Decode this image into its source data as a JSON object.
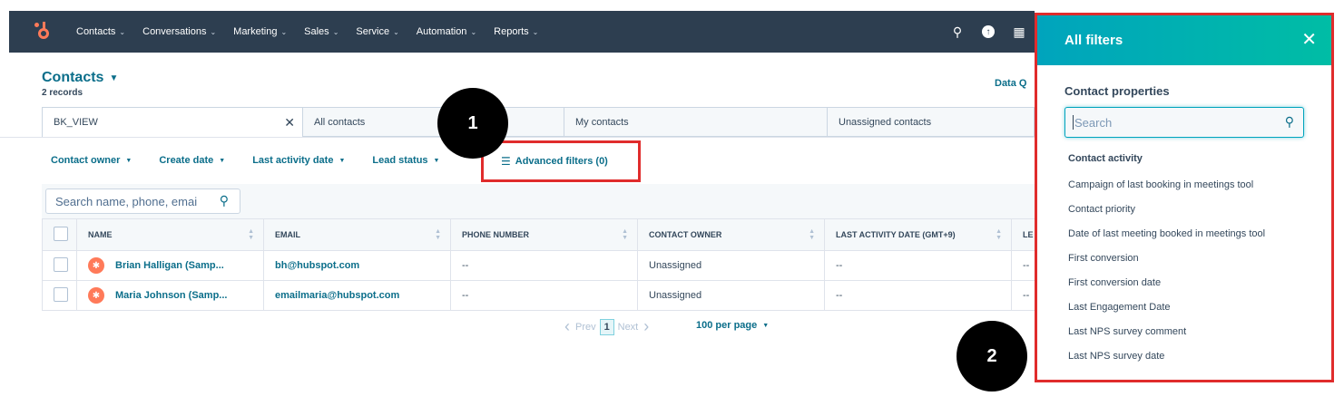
{
  "nav": {
    "items": [
      {
        "label": "Contacts"
      },
      {
        "label": "Conversations"
      },
      {
        "label": "Marketing"
      },
      {
        "label": "Sales"
      },
      {
        "label": "Service"
      },
      {
        "label": "Automation"
      },
      {
        "label": "Reports"
      }
    ],
    "icons": [
      "search-icon",
      "upgrade-icon",
      "marketplace-icon"
    ]
  },
  "header": {
    "title": "Contacts",
    "records": "2 records",
    "data_quality": "Data Q"
  },
  "views": [
    {
      "label": "BK_VIEW"
    },
    {
      "label": "All contacts"
    },
    {
      "label": "My contacts"
    },
    {
      "label": "Unassigned contacts"
    }
  ],
  "filters": {
    "items": [
      {
        "label": "Contact owner"
      },
      {
        "label": "Create date"
      },
      {
        "label": "Last activity date"
      },
      {
        "label": "Lead status"
      }
    ],
    "advanced": "Advanced filters (0)"
  },
  "table": {
    "search_placeholder": "Search name, phone, emai",
    "columns": [
      "NAME",
      "EMAIL",
      "PHONE NUMBER",
      "CONTACT OWNER",
      "LAST ACTIVITY DATE (GMT+9)",
      "LE"
    ],
    "rows": [
      {
        "name": "Brian Halligan (Samp...",
        "email": "bh@hubspot.com",
        "phone": "--",
        "owner": "Unassigned",
        "last_activity": "--",
        "extra": "--"
      },
      {
        "name": "Maria Johnson (Samp...",
        "email": "emailmaria@hubspot.com",
        "phone": "--",
        "owner": "Unassigned",
        "last_activity": "--",
        "extra": "--"
      }
    ]
  },
  "pagination": {
    "prev": "Prev",
    "page": "1",
    "next": "Next",
    "per_page": "100 per page"
  },
  "badges": {
    "one": "1",
    "two": "2"
  },
  "panel": {
    "title": "All filters",
    "section_title": "Contact properties",
    "search_placeholder": "Search",
    "group_title": "Contact activity",
    "properties": [
      "Campaign of last booking in meetings tool",
      "Contact priority",
      "Date of last meeting booked in meetings tool",
      "First conversion",
      "First conversion date",
      "Last Engagement Date",
      "Last NPS survey comment",
      "Last NPS survey date"
    ]
  },
  "colors": {
    "nav_bg": "#2d3e50",
    "link": "#0b6e8a",
    "accent": "#00a4bd",
    "brand": "#ff7a59",
    "highlight": "#e02c2c"
  }
}
